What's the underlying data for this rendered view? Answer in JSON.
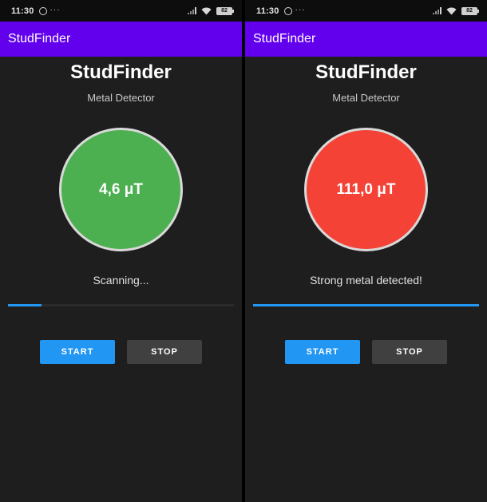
{
  "screens": [
    {
      "status_bar": {
        "time": "11:30",
        "dots": "···",
        "battery": "82"
      },
      "app_bar": {
        "title": "StudFinder"
      },
      "title": "StudFinder",
      "subtitle": "Metal Detector",
      "gauge": {
        "value": "4,6 μT",
        "color": "#4caf50"
      },
      "status_text": "Scanning...",
      "progress": 0.15,
      "buttons": {
        "start": "START",
        "stop": "STOP"
      }
    },
    {
      "status_bar": {
        "time": "11:30",
        "dots": "···",
        "battery": "82"
      },
      "app_bar": {
        "title": "StudFinder"
      },
      "title": "StudFinder",
      "subtitle": "Metal Detector",
      "gauge": {
        "value": "111,0 μT",
        "color": "#f44336"
      },
      "status_text": "Strong metal detected!",
      "progress": 1.0,
      "buttons": {
        "start": "START",
        "stop": "STOP"
      }
    }
  ],
  "colors": {
    "app_bar": "#6200ee",
    "accent": "#2196f3",
    "background": "#1e1e1e"
  }
}
